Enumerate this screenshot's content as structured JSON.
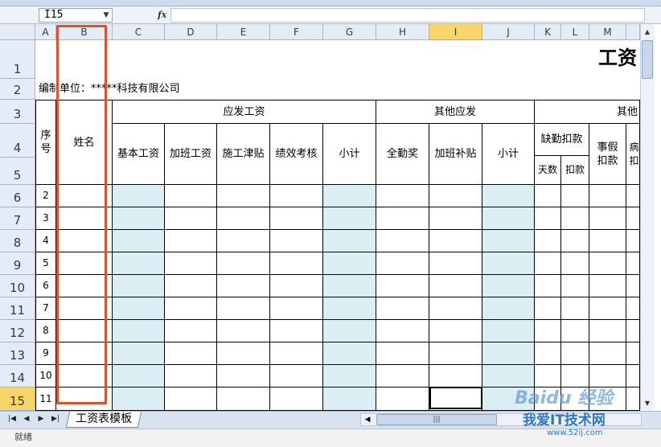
{
  "formula_bar": {
    "name_box": "I15",
    "fx": "fx",
    "formula": ""
  },
  "columns": [
    "A",
    "B",
    "C",
    "D",
    "E",
    "F",
    "G",
    "H",
    "I",
    "J",
    "K",
    "L",
    "M"
  ],
  "selected_column": "I",
  "rows": [
    "1",
    "2",
    "3",
    "4",
    "5",
    "6",
    "7",
    "8",
    "9",
    "10",
    "11",
    "12",
    "13",
    "14",
    "15"
  ],
  "selected_row": "15",
  "sheet": {
    "title": "工资",
    "unit_label": "编制单位：*****科技有限公司",
    "header": {
      "seq": "序号",
      "name": "姓名",
      "group_salary": "应发工资",
      "base": "基本工资",
      "overtime": "加班工资",
      "construction": "施工津贴",
      "performance": "绩效考核",
      "subtotal1": "小计",
      "group_other_pay": "其他应发",
      "attendance": "全勤奖",
      "overtime_subsidy": "加班补贴",
      "subtotal2": "小计",
      "group_other_deduct": "其他",
      "absence": "缺勤扣款",
      "days": "天数",
      "deduct": "扣款",
      "personal_leave": "事假扣款",
      "sick": "病扣"
    },
    "seq_values": [
      "2",
      "3",
      "4",
      "5",
      "6",
      "7",
      "8",
      "9",
      "10",
      "11"
    ]
  },
  "tabs": {
    "active": "工资表模板"
  },
  "status": {
    "text": "就绪"
  },
  "watermark": {
    "brand": "Baidu 经验",
    "site": "我爱IT技术网",
    "url": "www.52ij.com"
  },
  "colors": {
    "highlight_box": "#d9532c",
    "shaded_cells": "#daeef3",
    "selected_header": "#f8d46a"
  }
}
